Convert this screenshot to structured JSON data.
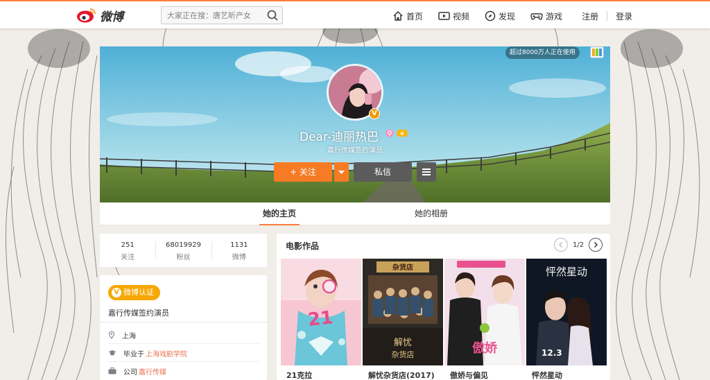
{
  "app": {
    "logo_text": "微博"
  },
  "search": {
    "placeholder": "大家正在搜：唐艺昕产女"
  },
  "nav": {
    "items": [
      {
        "label": "首页",
        "icon": "home-icon"
      },
      {
        "label": "视频",
        "icon": "video-icon"
      },
      {
        "label": "发现",
        "icon": "compass-icon"
      },
      {
        "label": "游戏",
        "icon": "gamepad-icon"
      }
    ],
    "register": "注册",
    "login": "登录"
  },
  "cover": {
    "users_note": "超过8000万人正在使用"
  },
  "profile": {
    "name": "Dear-迪丽热巴",
    "desc": "嘉行传媒签约演员",
    "verified_badge": "V"
  },
  "actions": {
    "follow": "+ 关注",
    "message": "私信"
  },
  "tabs": {
    "home": "她的主页",
    "album": "她的相册"
  },
  "stats": [
    {
      "num": "251",
      "label": "关注"
    },
    {
      "num": "68019929",
      "label": "粉丝"
    },
    {
      "num": "1131",
      "label": "微博"
    }
  ],
  "info": {
    "verify_label": "微博认证",
    "verify_text": "嘉行传媒签约演员",
    "location": "上海",
    "school_prefix": "毕业于",
    "school": "上海戏剧学院",
    "company_prefix": "公司",
    "company": "嘉行传媒"
  },
  "movies": {
    "title": "电影作品",
    "page": "1/2",
    "items": [
      {
        "name": "21克拉"
      },
      {
        "name": "解忧杂货店(2017)"
      },
      {
        "name": "傲娇与偏见"
      },
      {
        "name": "怦然星动"
      }
    ]
  },
  "colors": {
    "accent": "#fa7d3c",
    "follow": "#f77b24",
    "verify": "#f7a700",
    "link": "#eb7350"
  }
}
